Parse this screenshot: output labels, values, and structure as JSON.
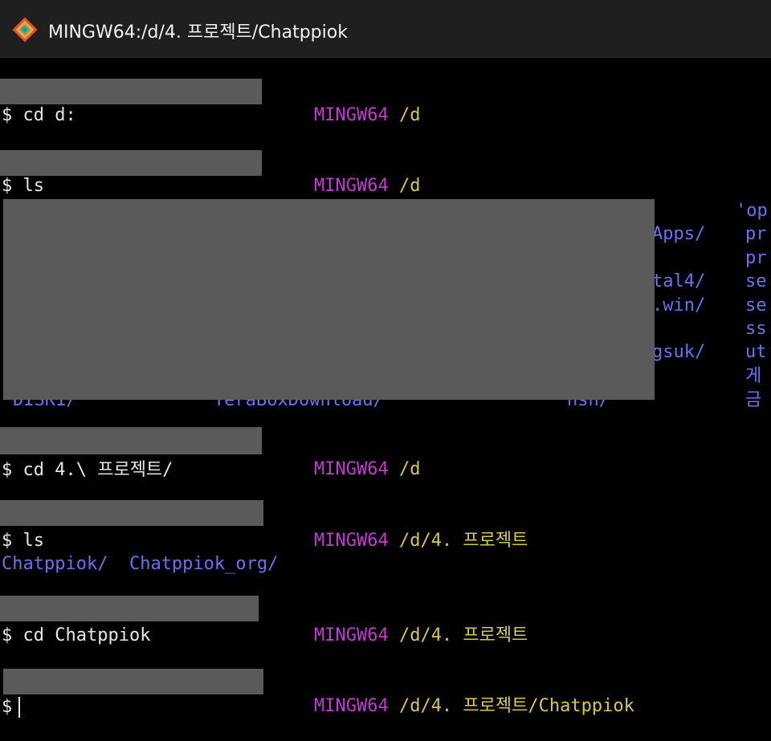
{
  "window": {
    "title": "MINGW64:/d/4. 프로젝트/Chatppiok"
  },
  "prompts": [
    {
      "env": "MINGW64",
      "path": "/d",
      "command": "cd d:"
    },
    {
      "env": "MINGW64",
      "path": "/d",
      "command": "ls"
    },
    {
      "env": "MINGW64",
      "path": "/d",
      "command": "cd 4.\\ 프로젝트/"
    },
    {
      "env": "MINGW64",
      "path": "/d/4. 프로젝트",
      "command": "ls"
    },
    {
      "env": "MINGW64",
      "path": "/d/4. 프로젝트",
      "command": "cd Chatppiok"
    },
    {
      "env": "MINGW64",
      "path": "/d/4. 프로젝트/Chatppiok",
      "command": ""
    }
  ],
  "prompt_symbol": "$",
  "ls_fragments": [
    "Apps/",
    "tal4/",
    ".win/",
    "gsuk/",
    "nsh/",
    "DISK1/",
    "TeraBoxDownload/"
  ],
  "ls_right_column": [
    "'op",
    "pr",
    "pr",
    "se",
    "se",
    "ss",
    "ut",
    "게",
    "금"
  ],
  "project_listing": [
    "Chatppiok/",
    "Chatppiok_org/"
  ],
  "colors": {
    "env": "#c33ad0",
    "path": "#d6c84a",
    "dir": "#6f6ff0",
    "text": "#e6e6e6"
  }
}
